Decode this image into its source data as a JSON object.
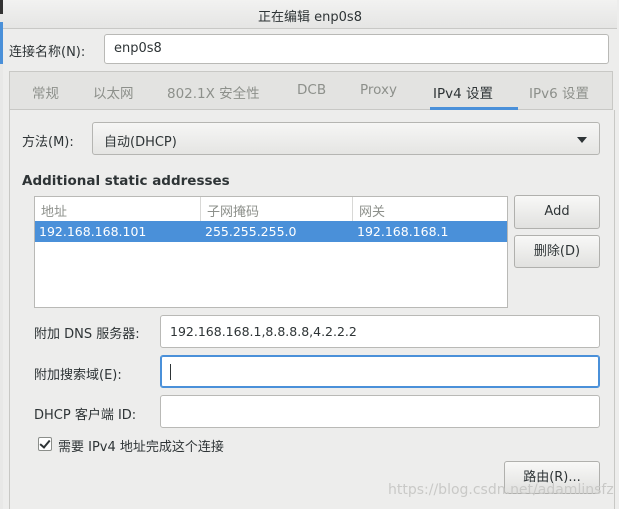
{
  "window": {
    "title": "正在编辑 enp0s8"
  },
  "connection": {
    "label": "连接名称(N):",
    "value": "enp0s8"
  },
  "tabs": [
    {
      "label": "常规"
    },
    {
      "label": "以太网"
    },
    {
      "label": "802.1X 安全性"
    },
    {
      "label": "DCB"
    },
    {
      "label": "Proxy"
    },
    {
      "label": "IPv4 设置"
    },
    {
      "label": "IPv6 设置"
    }
  ],
  "active_tab": "IPv4 设置",
  "method": {
    "label": "方法(M):",
    "value": "自动(DHCP)"
  },
  "static": {
    "title": "Additional static addresses",
    "columns": [
      "地址",
      "子网掩码",
      "网关"
    ],
    "rows": [
      [
        "192.168.168.101",
        "255.255.255.0",
        "192.168.168.1"
      ]
    ],
    "add_label": "Add",
    "delete_label": "删除(D)"
  },
  "dns": {
    "label": "附加 DNS 服务器:",
    "value": "192.168.168.1,8.8.8.8,4.2.2.2"
  },
  "search": {
    "label": "附加搜索域(E):",
    "value": ""
  },
  "dhcp": {
    "label": "DHCP 客户端 ID:",
    "value": ""
  },
  "require_ipv4": {
    "label": "需要 IPv4 地址完成这个连接",
    "checked": true
  },
  "route_label": "路由(R)...",
  "watermark": "https://blog.csdn.net/adamlinsfz",
  "colors": {
    "accent": "#4a90d9",
    "background": "#ededec"
  }
}
